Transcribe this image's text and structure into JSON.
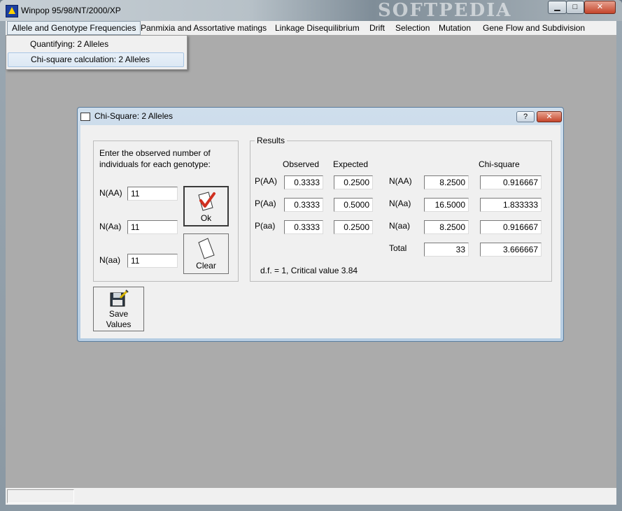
{
  "window": {
    "title": "Winpop 95/98/NT/2000/XP",
    "watermark": "SOFTPEDIA",
    "min_glyph": "▁",
    "max_glyph": "□",
    "close_glyph": "✕"
  },
  "menubar": {
    "items": [
      "Allele and Genotype Frequencies",
      "Panmixia and Assortative matings",
      "Linkage Disequilibrium",
      "Drift",
      "Selection",
      "Mutation",
      "Gene Flow and Subdivision"
    ]
  },
  "dropdown": {
    "items": [
      "Quantifying: 2 Alleles",
      "Chi-square calculation: 2 Alleles"
    ]
  },
  "dialog": {
    "title": "Chi-Square: 2 Alleles",
    "help_glyph": "?",
    "close_glyph": "✕",
    "prompt": "Enter the observed number of individuals for each genotype:",
    "inputs": [
      {
        "label": "N(AA)",
        "value": "11"
      },
      {
        "label": "N(Aa)",
        "value": "11"
      },
      {
        "label": "N(aa)",
        "value": "11"
      }
    ],
    "ok_label": "Ok",
    "clear_label": "Clear",
    "save_label_1": "Save",
    "save_label_2": "Values",
    "results": {
      "legend": "Results",
      "headers": {
        "observed": "Observed",
        "expected": "Expected",
        "chisq": "Chi-square"
      },
      "freq_rows": [
        {
          "label": "P(AA)",
          "observed": "0.3333",
          "expected": "0.2500"
        },
        {
          "label": "P(Aa)",
          "observed": "0.3333",
          "expected": "0.5000"
        },
        {
          "label": "P(aa)",
          "observed": "0.3333",
          "expected": "0.2500"
        }
      ],
      "count_rows": [
        {
          "label": "N(AA)",
          "value": "8.2500",
          "chisq": "0.916667"
        },
        {
          "label": "N(Aa)",
          "value": "16.5000",
          "chisq": "1.833333"
        },
        {
          "label": "N(aa)",
          "value": "8.2500",
          "chisq": "0.916667"
        }
      ],
      "total": {
        "label": "Total",
        "value": "33",
        "chisq": "3.666667"
      },
      "df_text": "d.f. = 1, Critical value 3.84"
    }
  },
  "colors": {
    "dialog_title_bg": "#cfdeec",
    "close_red": "#c5462c",
    "check_red": "#d03020"
  }
}
